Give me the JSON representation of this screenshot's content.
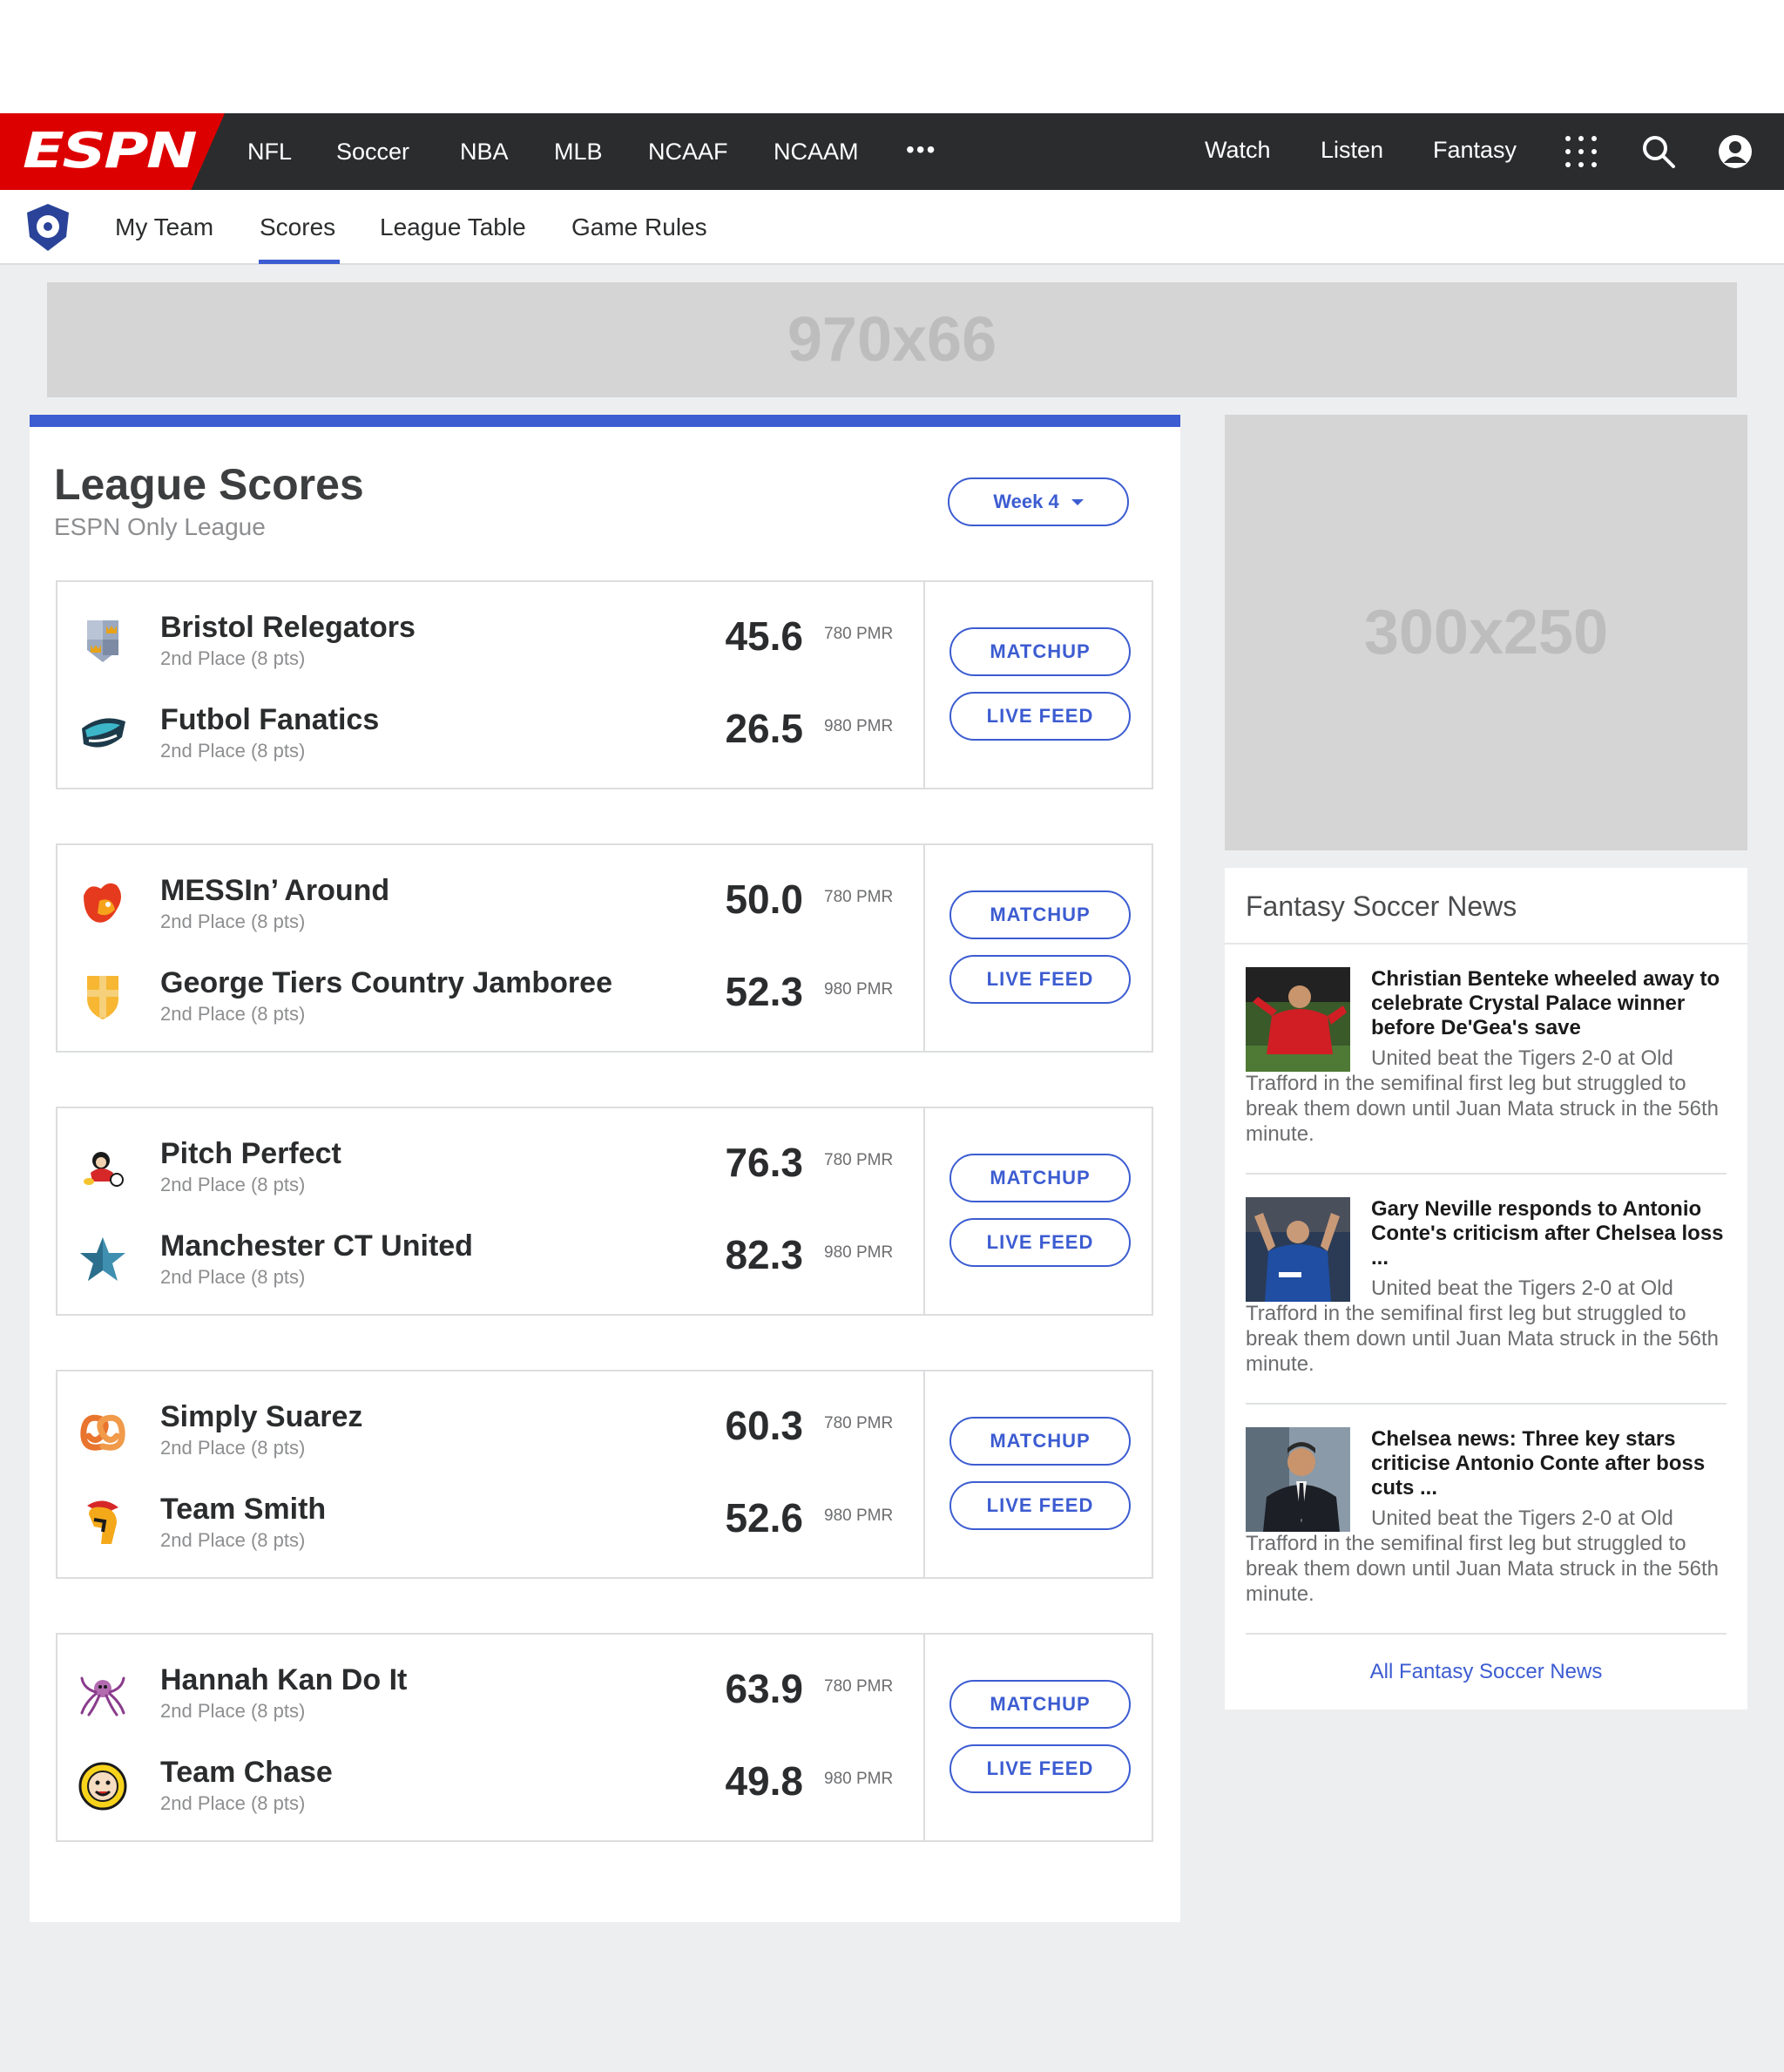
{
  "nav": {
    "logo": "ESPN",
    "items": [
      "NFL",
      "Soccer",
      "NBA",
      "MLB",
      "NCAAF",
      "NCAAM"
    ],
    "more": "•••",
    "right": [
      "Watch",
      "Listen",
      "Fantasy"
    ]
  },
  "subnav": {
    "items": [
      "My Team",
      "Scores",
      "League Table",
      "Game Rules"
    ],
    "active": "Scores"
  },
  "ads": {
    "top": "970x66",
    "side": "300x250"
  },
  "scores": {
    "title": "League Scores",
    "subtitle": "ESPN Only League",
    "week": "Week 4",
    "matchup_label": "MATCHUP",
    "livefeed_label": "LIVE FEED",
    "matches": [
      {
        "teams": [
          {
            "name": "Bristol Relegators",
            "place": "2nd Place (8 pts)",
            "score": "45.6",
            "pmr": "780 PMR",
            "logo": "shield-crown-icon"
          },
          {
            "name": "Futbol Fanatics",
            "place": "2nd Place (8 pts)",
            "score": "26.5",
            "pmr": "980 PMR",
            "logo": "dolphin-icon"
          }
        ]
      },
      {
        "teams": [
          {
            "name": "MESSIn’ Around",
            "place": "2nd Place (8 pts)",
            "score": "50.0",
            "pmr": "780 PMR",
            "logo": "phoenix-icon"
          },
          {
            "name": "George Tiers Country Jamboree",
            "place": "2nd Place (8 pts)",
            "score": "52.3",
            "pmr": "980 PMR",
            "logo": "cross-shield-icon"
          }
        ]
      },
      {
        "teams": [
          {
            "name": "Pitch Perfect",
            "place": "2nd Place (8 pts)",
            "score": "76.3",
            "pmr": "780 PMR",
            "logo": "cartoon-soccer-icon"
          },
          {
            "name": "Manchester CT United",
            "place": "2nd Place (8 pts)",
            "score": "82.3",
            "pmr": "980 PMR",
            "logo": "star-icon"
          }
        ]
      },
      {
        "teams": [
          {
            "name": "Simply Suarez",
            "place": "2nd Place (8 pts)",
            "score": "60.3",
            "pmr": "780 PMR",
            "logo": "pretzel-icon"
          },
          {
            "name": "Team Smith",
            "place": "2nd Place (8 pts)",
            "score": "52.6",
            "pmr": "980 PMR",
            "logo": "spartan-helmet-icon"
          }
        ]
      },
      {
        "teams": [
          {
            "name": "Hannah Kan Do It",
            "place": "2nd Place (8 pts)",
            "score": "63.9",
            "pmr": "780 PMR",
            "logo": "octopus-icon"
          },
          {
            "name": "Team Chase",
            "place": "2nd Place (8 pts)",
            "score": "49.8",
            "pmr": "980 PMR",
            "logo": "face-badge-icon"
          }
        ]
      }
    ]
  },
  "news": {
    "title": "Fantasy Soccer News",
    "items": [
      {
        "headline": "Christian Benteke wheeled away to celebrate Crystal Palace winner before De'Gea's save",
        "body": "United beat the Tigers 2-0 at Old Trafford in the semifinal first leg but struggled to break them down until Juan Mata struck in the 56th minute.",
        "image": "player-red-kit"
      },
      {
        "headline": "Gary Neville responds to Antonio Conte's criticism after Chelsea loss ...",
        "body": "United beat the Tigers 2-0 at Old Trafford in the semifinal first leg but struggled to break them down until Juan Mata struck in the 56th minute.",
        "image": "player-blue-kit"
      },
      {
        "headline": "Chelsea news: Three key stars criticise Antonio Conte after boss cuts ...",
        "body": "United beat the Tigers 2-0 at Old Trafford in the semifinal first leg but struggled to break them down until Juan Mata struck in the 56th minute.",
        "image": "manager-suit"
      }
    ],
    "all_link": "All Fantasy Soccer News"
  },
  "colors": {
    "brand_red": "#dd0000",
    "accent_blue": "#3c5cd1",
    "nav_dark": "#2b2c2d"
  }
}
